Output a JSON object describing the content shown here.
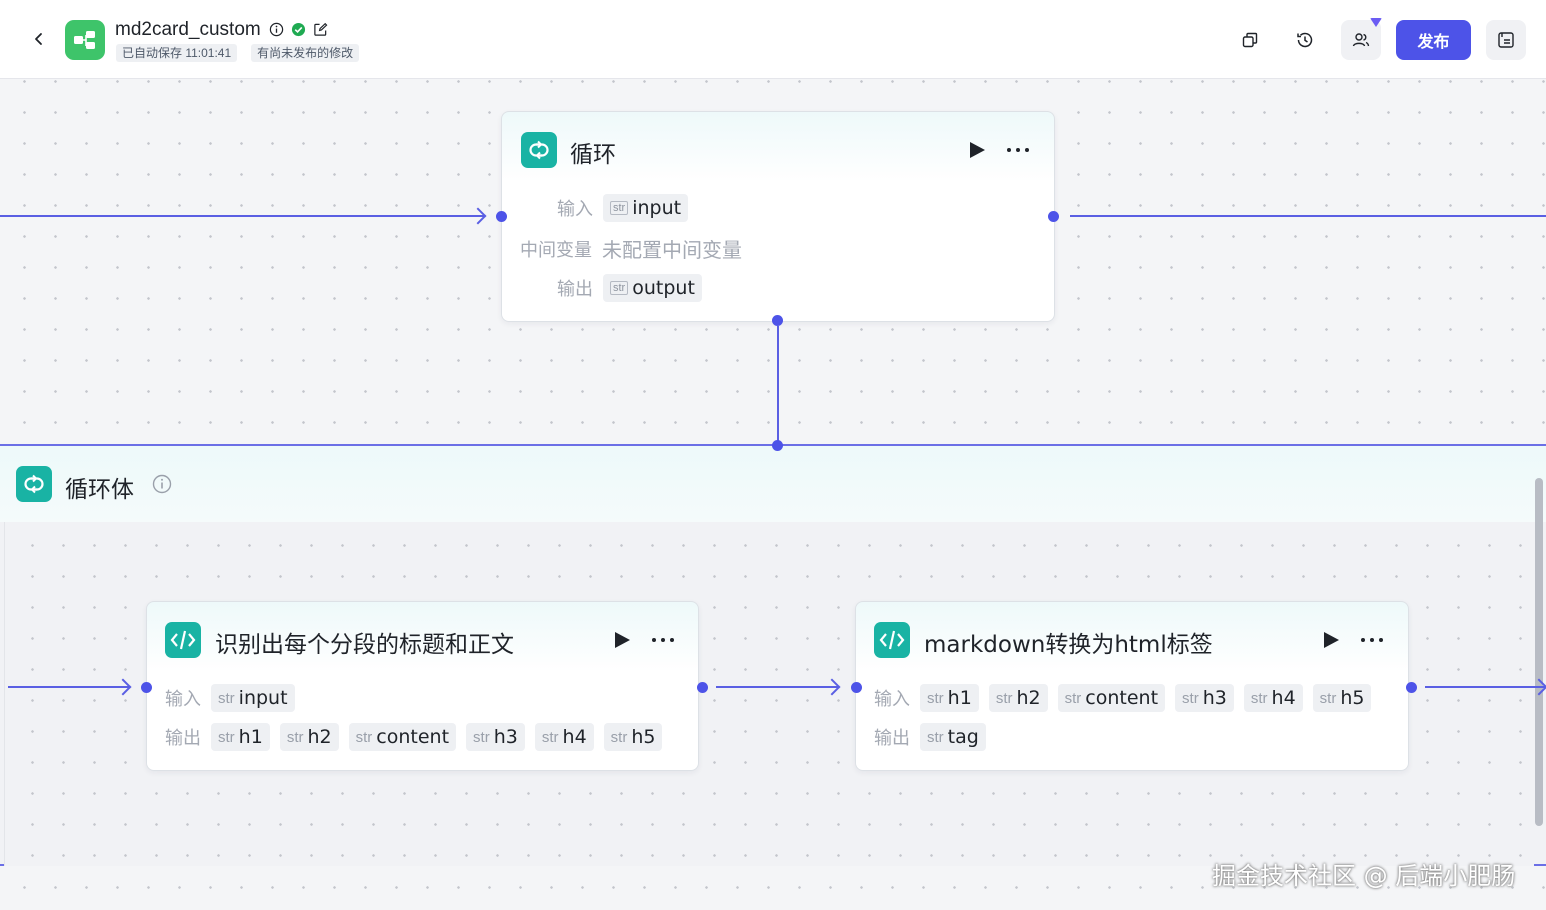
{
  "header": {
    "app_name": "md2card_custom",
    "autosave": "已自动保存 11:01:41",
    "unpublished": "有尚未发布的修改",
    "publish_label": "发布",
    "status_color": "#1faa52",
    "accent": "#4d53e8"
  },
  "loop_node": {
    "title": "循环",
    "input_label": "输入",
    "input_type": "str",
    "input_name": "input",
    "variable_label": "中间变量",
    "variable_value": "未配置中间变量",
    "output_label": "输出",
    "output_type": "str",
    "output_name": "output"
  },
  "loop_body": {
    "title": "循环体"
  },
  "node_a": {
    "title": "识别出每个分段的标题和正文",
    "input_label": "输入",
    "inputs": [
      {
        "type": "str",
        "name": "input"
      }
    ],
    "output_label": "输出",
    "outputs": [
      {
        "type": "str",
        "name": "h1"
      },
      {
        "type": "str",
        "name": "h2"
      },
      {
        "type": "str",
        "name": "content"
      },
      {
        "type": "str",
        "name": "h3"
      },
      {
        "type": "str",
        "name": "h4"
      },
      {
        "type": "str",
        "name": "h5"
      }
    ]
  },
  "node_b": {
    "title": "markdown转换为html标签",
    "input_label": "输入",
    "inputs": [
      {
        "type": "str",
        "name": "h1"
      },
      {
        "type": "str",
        "name": "h2"
      },
      {
        "type": "str",
        "name": "content"
      },
      {
        "type": "str",
        "name": "h3"
      },
      {
        "type": "str",
        "name": "h4"
      },
      {
        "type": "str",
        "name": "h5"
      }
    ],
    "output_label": "输出",
    "outputs": [
      {
        "type": "str",
        "name": "tag"
      }
    ]
  },
  "watermark": "掘金技术社区 @ 后端小肥肠",
  "icons": {
    "back": "chevron-left-icon",
    "info": "info-icon",
    "published": "check-circle-icon",
    "edit": "edit-icon",
    "copy": "copy-icon",
    "history": "history-icon",
    "collaborators": "users-icon",
    "panel": "panel-icon",
    "loop": "loop-icon",
    "code": "code-icon",
    "run": "play-icon",
    "more": "more-icon"
  }
}
